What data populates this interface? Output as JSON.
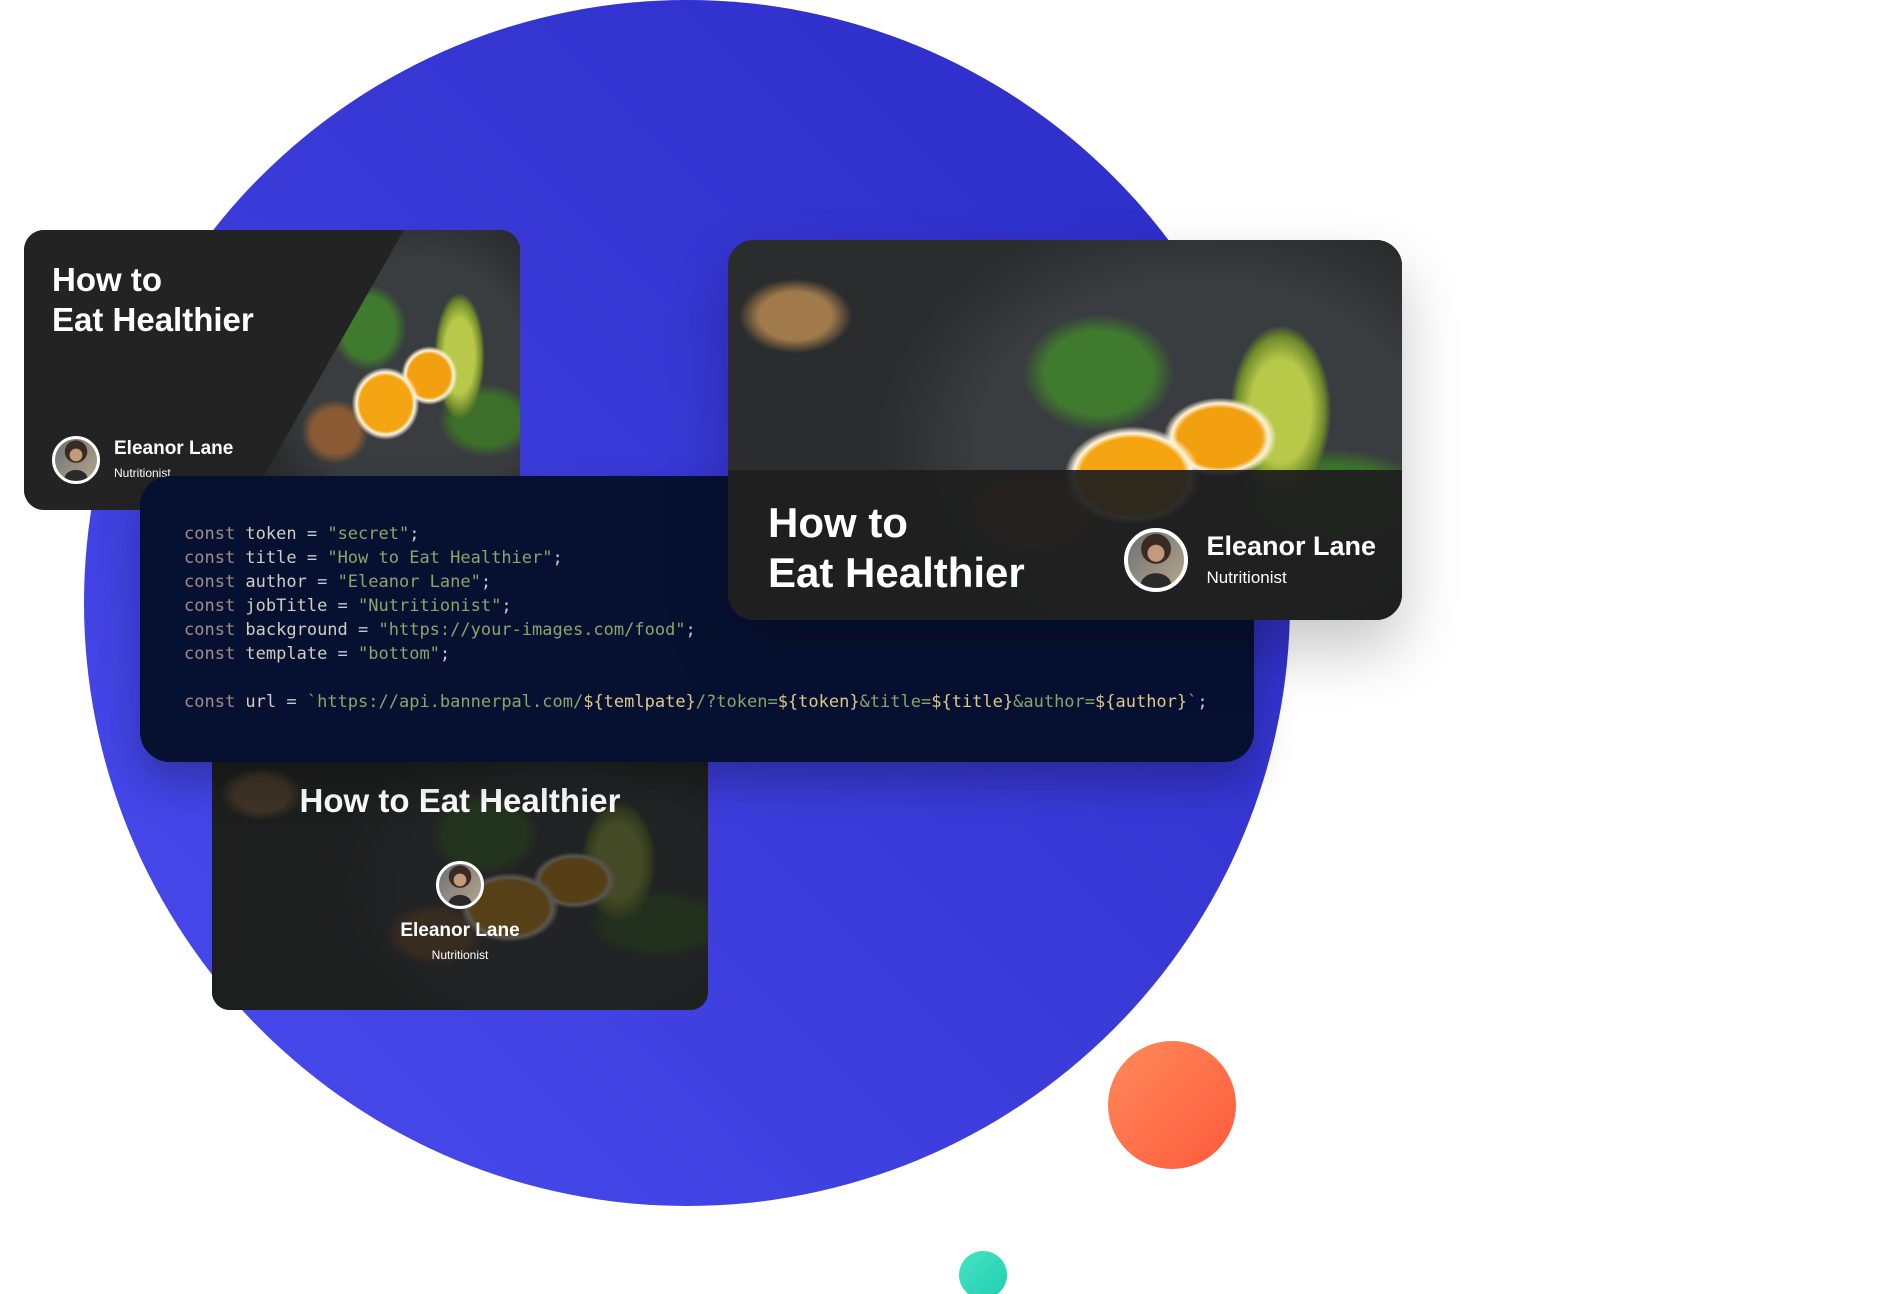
{
  "colors": {
    "circle": "#3a3ad8",
    "orange_dot": "#ff6b47",
    "teal_dot": "#2fdcbc",
    "code_bg": "#061031",
    "card_bg": "#232323"
  },
  "cards": {
    "left": {
      "title_line1": "How to",
      "title_line2": "Eat Healthier",
      "author": "Eleanor Lane",
      "job": "Nutritionist"
    },
    "right": {
      "title_line1": "How to",
      "title_line2": "Eat Healthier",
      "author": "Eleanor Lane",
      "job": "Nutritionist"
    },
    "bottom": {
      "title": "How to Eat Healthier",
      "author": "Eleanor Lane",
      "job": "Nutritionist"
    }
  },
  "code": {
    "lines": [
      [
        {
          "c": "kw",
          "t": "const "
        },
        {
          "c": "id",
          "t": "token"
        },
        {
          "c": "op",
          "t": " = "
        },
        {
          "c": "str",
          "t": "\"secret\""
        },
        {
          "c": "op",
          "t": ";"
        }
      ],
      [
        {
          "c": "kw",
          "t": "const "
        },
        {
          "c": "id",
          "t": "title"
        },
        {
          "c": "op",
          "t": " = "
        },
        {
          "c": "str",
          "t": "\"How to Eat Healthier\""
        },
        {
          "c": "op",
          "t": ";"
        }
      ],
      [
        {
          "c": "kw",
          "t": "const "
        },
        {
          "c": "id",
          "t": "author"
        },
        {
          "c": "op",
          "t": " = "
        },
        {
          "c": "str",
          "t": "\"Eleanor Lane\""
        },
        {
          "c": "op",
          "t": ";"
        }
      ],
      [
        {
          "c": "kw",
          "t": "const "
        },
        {
          "c": "id",
          "t": "jobTitle"
        },
        {
          "c": "op",
          "t": " = "
        },
        {
          "c": "str",
          "t": "\"Nutritionist\""
        },
        {
          "c": "op",
          "t": ";"
        }
      ],
      [
        {
          "c": "kw",
          "t": "const "
        },
        {
          "c": "id",
          "t": "background"
        },
        {
          "c": "op",
          "t": " = "
        },
        {
          "c": "str",
          "t": "\"https://your-images.com/food\""
        },
        {
          "c": "op",
          "t": ";"
        }
      ],
      [
        {
          "c": "kw",
          "t": "const "
        },
        {
          "c": "id",
          "t": "template"
        },
        {
          "c": "op",
          "t": " = "
        },
        {
          "c": "str",
          "t": "\"bottom\""
        },
        {
          "c": "op",
          "t": ";"
        }
      ],
      [],
      [
        {
          "c": "kw",
          "t": "const "
        },
        {
          "c": "id",
          "t": "url"
        },
        {
          "c": "op",
          "t": " = "
        },
        {
          "c": "str",
          "t": "`https://api.bannerpal.com/"
        },
        {
          "c": "tpl",
          "t": "${temlpate}"
        },
        {
          "c": "str",
          "t": "/?token="
        },
        {
          "c": "tpl",
          "t": "${token}"
        },
        {
          "c": "str",
          "t": "&title="
        },
        {
          "c": "tpl",
          "t": "${title}"
        },
        {
          "c": "str",
          "t": "&author="
        },
        {
          "c": "tpl",
          "t": "${author}"
        },
        {
          "c": "str",
          "t": "`"
        },
        {
          "c": "op",
          "t": ";"
        }
      ]
    ]
  }
}
